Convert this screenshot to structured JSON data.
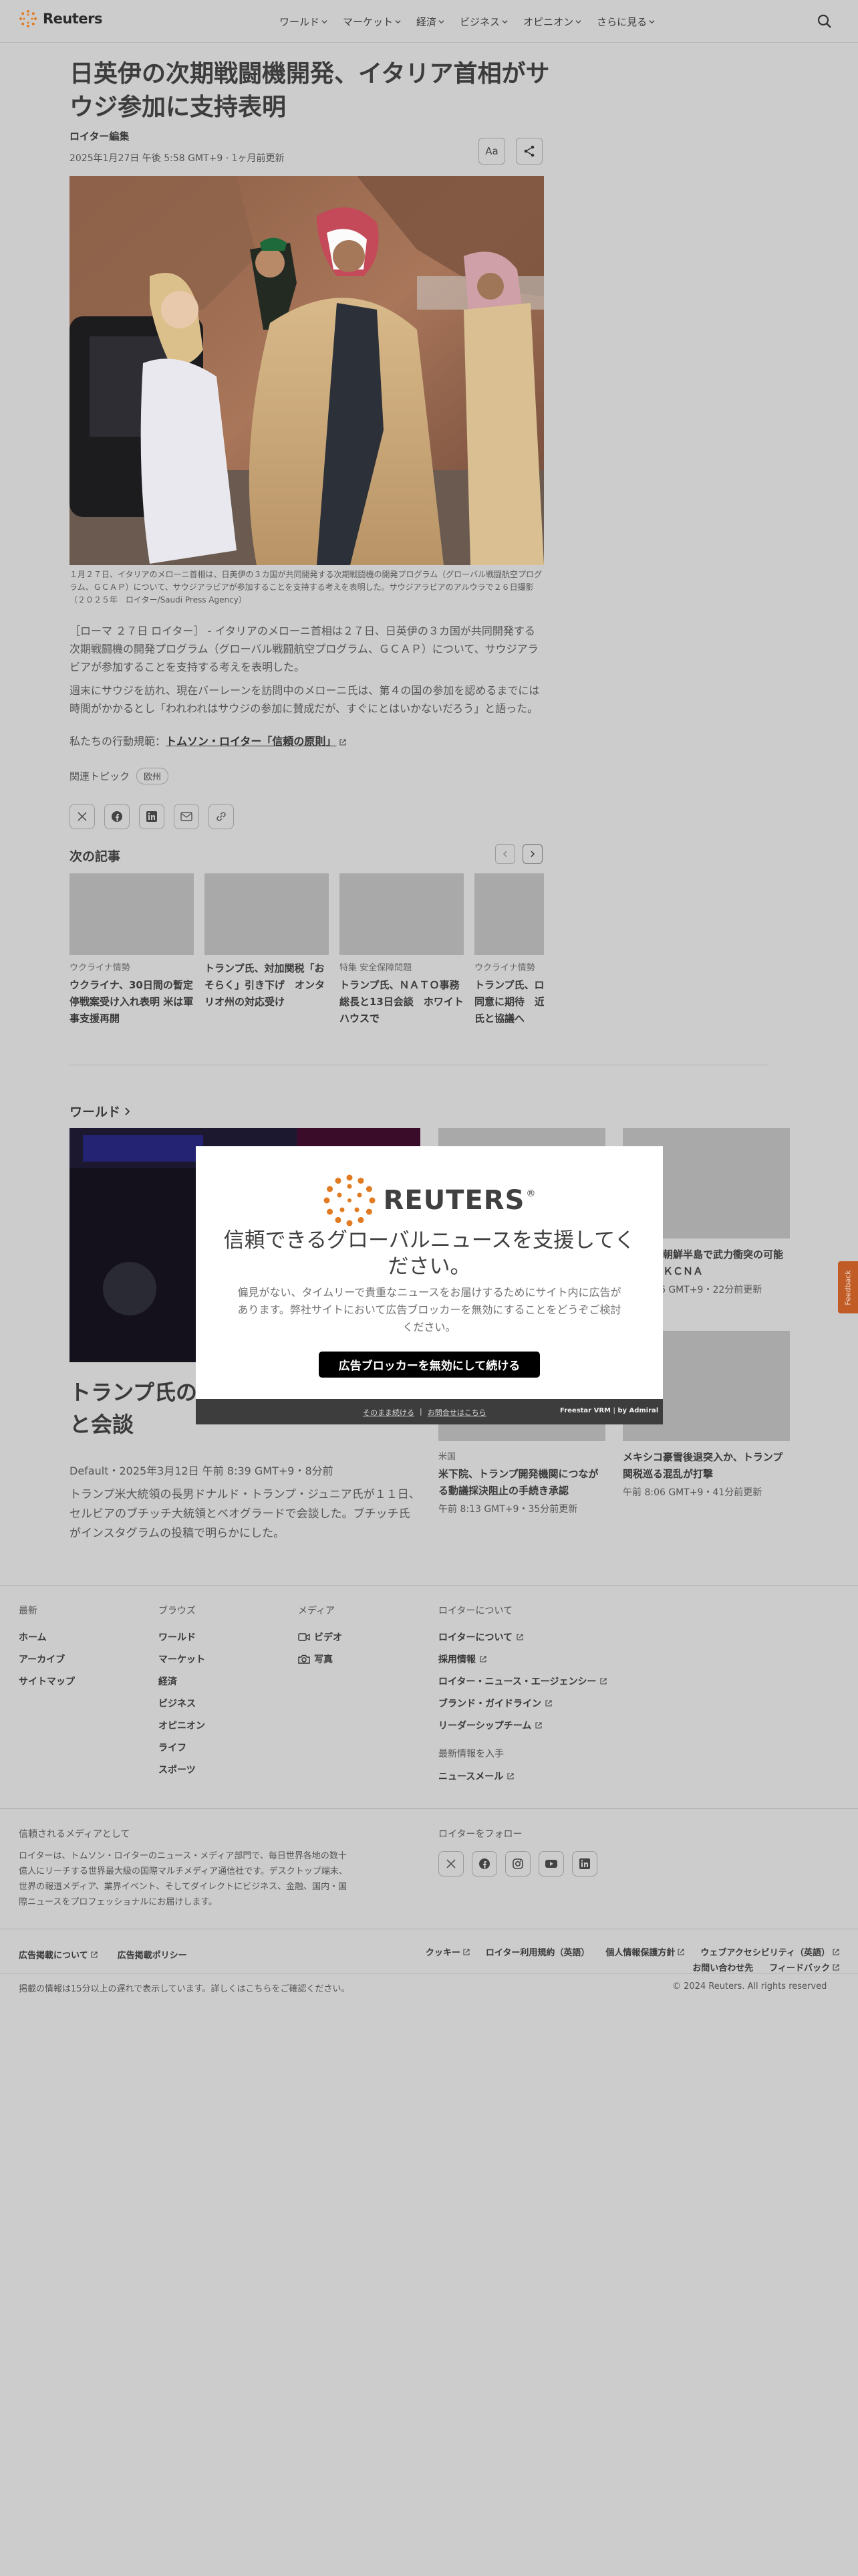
{
  "header": {
    "logo_text": "Reuters",
    "nav": [
      "ワールド",
      "マーケット",
      "経済",
      "ビジネス",
      "オピニオン",
      "さらに見る"
    ]
  },
  "article": {
    "headline": "日英伊の次期戦闘機開発、イタリア首相がサウジ参加に支持表明",
    "byline": "ロイター編集",
    "dateline": "2025年1月27日 午後 5:58 GMT+9 · 1ヶ月前更新",
    "font_button": "Aa",
    "caption": "１月２７日、イタリアのメローニ首相は、日英伊の３カ国が共同開発する次期戦闘機の開発プログラム（グローバル戦闘航空プログラム、ＧＣＡＰ）について、サウジアラビアが参加することを支持する考えを表明した。サウジアラビアのアルウラで２６日撮影（２０２５年　ロイター/Saudi Press Agency）",
    "paragraphs": [
      "［ローマ ２７日 ロイター］ - イタリアのメローニ首相は２７日、日英伊の３カ国が共同開発する次期戦闘機の開発プログラム（グローバル戦闘航空プログラム、ＧＣＡＰ）について、サウジアラビアが参加することを支持する考えを表明した。",
      "週末にサウジを訪れ、現在バーレーンを訪問中のメローニ氏は、第４の国の参加を認めるまでには時間がかかるとし「われわれはサウジの参加に賛成だが、すぐにとはいかないだろう」と語った。"
    ],
    "principles_label": "私たちの行動規範：",
    "principles_link": "トムソン・ロイター「信頼の原則」",
    "topics_label": "関連トピック",
    "topic": "欧州"
  },
  "next": {
    "title": "次の記事",
    "cards": [
      {
        "kicker": "ウクライナ情勢",
        "headline": "ウクライナ、30日間の暫定停戦案受け入れ表明 米は軍事支援再開"
      },
      {
        "kicker": "",
        "headline": "トランプ氏、対加関税「おそらく」引き下げ　オンタリオ州の対応受け"
      },
      {
        "kicker": "特集 安全保障問題",
        "headline": "トランプ氏、ＮＡＴＯ事務総長と13日会談　ホワイトハウスで"
      },
      {
        "kicker": "ウクライナ情勢",
        "headline": "トランプ氏、ロシアの停戦同意に期待　近くプーチン氏と協議へ"
      }
    ]
  },
  "world": {
    "title": "ワールド",
    "main": {
      "headline": "トランプ氏の長男、ブチッチ大統領と会談",
      "meta": "Default・2025年3月12日 午前 8:39 GMT+9・8分前",
      "desc": "トランプ米大統領の長男ドナルド・トランプ・ジュニア氏が１１日、セルビアのブチッチ大統領とベオグラードで会談した。ブチッチ氏がインスタグラムの投稿で明らかにした。"
    },
    "side": [
      {
        "kicker": "",
        "headline": "北朝鮮、朝鮮半島で武力衝突の可能性示すーＫＣＮＡ",
        "meta": "午前 8:06 GMT+9・22分前更新"
      },
      {
        "kicker": "米国",
        "headline": "米下院、トランプ開発機関につながる動議採決阻止の手続き承認",
        "meta": "午前 8:13 GMT+9・35分前更新"
      },
      {
        "kicker": "",
        "headline": "メキシコ豪雪後退突入か、トランプ関税巡る混乱が打撃",
        "meta": "午前 8:06 GMT+9・41分前更新"
      }
    ]
  },
  "feedback": "Feedback",
  "modal": {
    "logo_text": "REUTERS",
    "title": "信頼できるグローバルニュースを支援してください。",
    "body": "偏見がない、タイムリーで貴重なニュースをお届けするためにサイト内に広告があります。弊社サイトにおいて広告ブロッカーを無効にすることをどうぞご検討ください。",
    "cta": "広告ブロッカーを無効にして続ける",
    "link_continue": "そのまま続ける",
    "link_contact": "お問合せはこちら",
    "brand": "Freestar VRM",
    "brand_by": "by Admiral"
  },
  "footer": {
    "cols": [
      {
        "title": "最新",
        "items": [
          "ホーム",
          "アーカイブ",
          "サイトマップ"
        ]
      },
      {
        "title": "ブラウズ",
        "items": [
          "ワールド",
          "マーケット",
          "経済",
          "ビジネス",
          "オピニオン",
          "ライフ",
          "スポーツ"
        ]
      },
      {
        "title": "メディア",
        "items": [
          "ビデオ",
          "写真"
        ]
      },
      {
        "title": "ロイターについて",
        "items": [
          "ロイターについて",
          "採用情報",
          "ロイター・ニュース・エージェンシー",
          "ブランド・ガイドライン",
          "リーダーシップチーム"
        ]
      }
    ],
    "subscribe_title": "最新情報を入手",
    "subscribe_item": "ニュースメール",
    "trusted_title": "信頼されるメディアとして",
    "trusted_body": "ロイターは、トムソン・ロイターのニュース・メディア部門で、毎日世界各地の数十億人にリーチする世界最大級の国際マルチメディア通信社です。デスクトップ端末、世界の報道メディア、業界イベント、そしてダイレクトにビジネス、金融、国内・国際ニュースをプロフェッショナルにお届けします。",
    "follow_title": "ロイターをフォロー",
    "legal_left": [
      "広告掲載について",
      "広告掲載ポリシー"
    ],
    "legal_right": [
      "クッキー",
      "ロイター利用規約（英語）",
      "個人情報保護方針",
      "ウェブアクセシビリティ（英語）",
      "お問い合わせ先",
      "フィードバック"
    ],
    "delay": "掲載の情報は15分以上の遅れで表示しています。詳しくはこちらをご確認ください。",
    "copyright": "© 2024 Reuters. All rights reserved"
  }
}
